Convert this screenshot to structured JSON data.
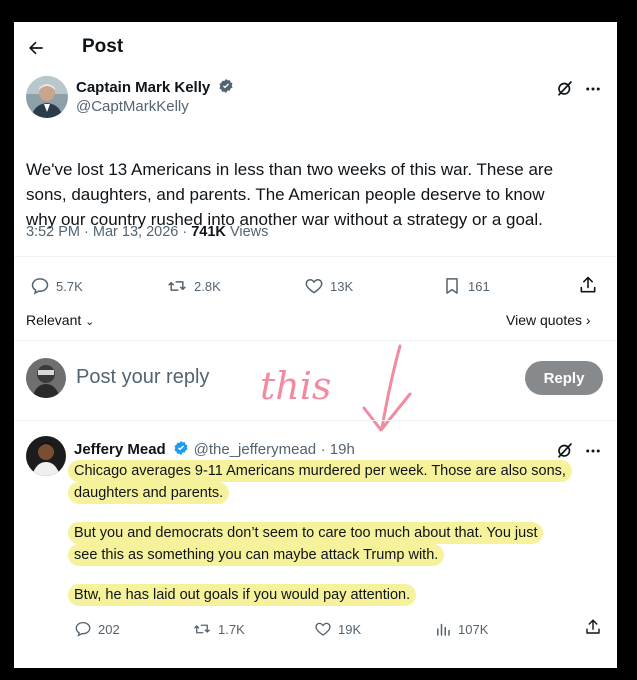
{
  "header": {
    "title": "Post"
  },
  "post": {
    "author_name": "Captain Mark Kelly",
    "author_handle": "@CaptMarkKelly",
    "text_line1": "We've lost 13 Americans in less than two weeks of this war. These are",
    "text_line2": "sons, daughters, and parents. The American people deserve to know",
    "text_line3": "why our country rushed into another war without a strategy or a goal.",
    "time": "3:52 PM",
    "date": "Mar 13, 2026",
    "views_count": "741K",
    "views_label": "Views",
    "replies": "5.7K",
    "reposts": "2.8K",
    "likes": "13K",
    "bookmarks": "161"
  },
  "sort": {
    "label": "Relevant",
    "view_quotes": "View quotes"
  },
  "composer": {
    "placeholder": "Post your reply",
    "button": "Reply"
  },
  "annotation": {
    "text": "this"
  },
  "reply": {
    "author_name": "Jeffery Mead",
    "author_handle": "@the_jefferymead",
    "time": "19h",
    "p1_line1": "Chicago averages 9-11 Americans murdered per week. Those are also sons,",
    "p1_line2": "daughters and parents.",
    "p2_line1": "But you and democrats don’t seem to care too much about that. You just",
    "p2_line2": "see this as something you can maybe attack Trump with.",
    "p3_line1": "Btw, he has laid out goals if you would pay attention.",
    "replies": "202",
    "reposts": "1.7K",
    "likes": "19K",
    "views": "107K"
  },
  "colors": {
    "verified": "#1d9bf0",
    "highlight": "#f6f29b",
    "annotation": "#f28aa0",
    "reply_button": "#878a8c"
  }
}
